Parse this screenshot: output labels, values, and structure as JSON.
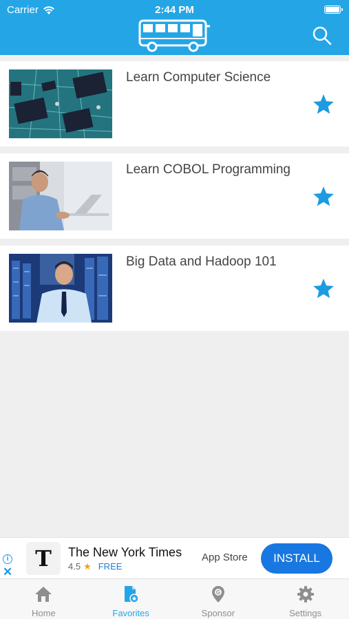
{
  "status_bar": {
    "carrier": "Carrier",
    "time": "2:44 PM"
  },
  "header": {
    "logo_icon": "bus-icon",
    "search_icon": "search-icon"
  },
  "courses": [
    {
      "title": "Learn Computer Science",
      "image": "circuit-board-image",
      "favorite": true
    },
    {
      "title": "Learn COBOL Programming",
      "image": "man-on-laptop-image",
      "favorite": true
    },
    {
      "title": "Big Data and Hadoop 101",
      "image": "man-in-datacenter-image",
      "favorite": true
    }
  ],
  "ad": {
    "app_name": "The New York Times",
    "logo_text": "T",
    "rating": "4.5",
    "price": "FREE",
    "store": "App Store",
    "install_label": "INSTALL"
  },
  "tabbar": {
    "home": "Home",
    "favorites": "Favorites",
    "sponsor": "Sponsor",
    "settings": "Settings",
    "active": "favorites"
  },
  "colors": {
    "accent": "#24a6e6",
    "star": "#1d9be2",
    "install_button": "#1877e0",
    "background": "#efefef"
  }
}
